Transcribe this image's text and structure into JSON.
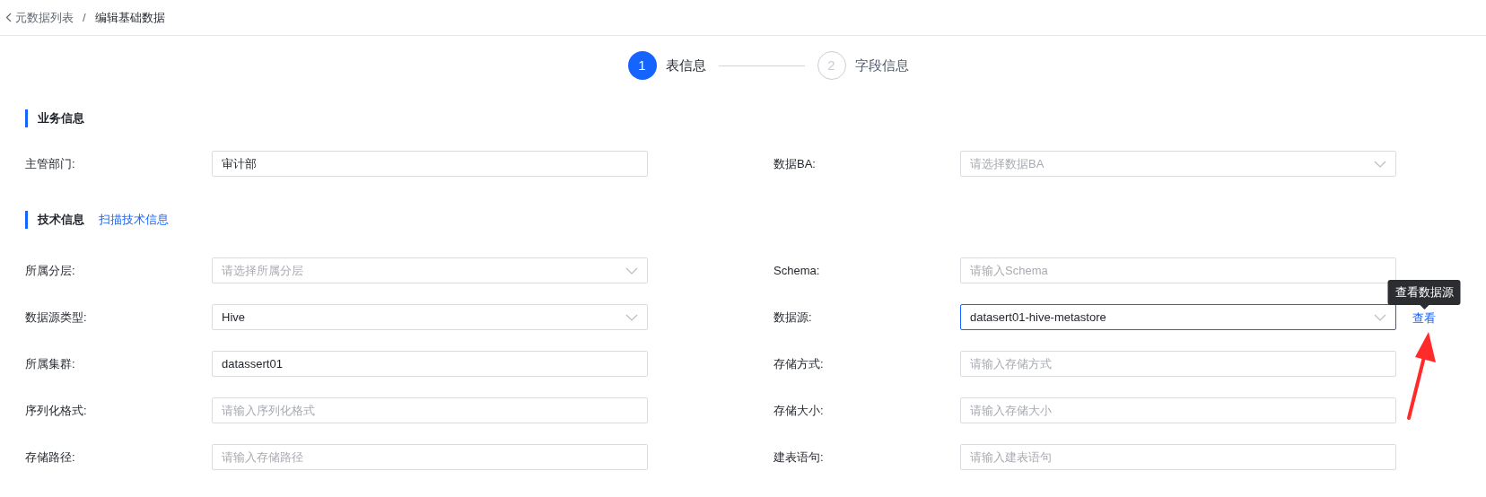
{
  "breadcrumb": {
    "back": "元数据列表",
    "separator": "/",
    "current": "编辑基础数据"
  },
  "steps": [
    {
      "number": "1",
      "label": "表信息",
      "selected": true
    },
    {
      "number": "2",
      "label": "字段信息",
      "selected": false
    }
  ],
  "sections": [
    {
      "title": "业务信息",
      "rows": [
        [
          {
            "label": "主管部门:",
            "kind": "input",
            "value": "审计部",
            "focused": false
          },
          {
            "label": "数据BA:",
            "kind": "select",
            "placeholder": "请选择数据BA",
            "focused": false
          }
        ]
      ]
    },
    {
      "title": "技术信息",
      "link": "扫描技术信息",
      "rows": [
        [
          {
            "label": "所属分层:",
            "kind": "select",
            "placeholder": "请选择所属分层",
            "focused": false
          },
          {
            "label": "Schema:",
            "kind": "input",
            "placeholder": "请输入Schema",
            "focused": false
          }
        ],
        [
          {
            "label": "数据源类型:",
            "kind": "select",
            "value": "Hive",
            "focused": false
          },
          {
            "label": "数据源:",
            "kind": "select",
            "value": "datasert01-hive-metastore",
            "focused": true,
            "action": {
              "label": "查看",
              "tooltip": "查看数据源"
            }
          }
        ],
        [
          {
            "label": "所属集群:",
            "kind": "input",
            "value": "datassert01",
            "focused": false
          },
          {
            "label": "存储方式:",
            "kind": "input",
            "placeholder": "请输入存储方式",
            "focused": false
          }
        ],
        [
          {
            "label": "序列化格式:",
            "kind": "input",
            "placeholder": "请输入序列化格式",
            "focused": false
          },
          {
            "label": "存储大小:",
            "kind": "input",
            "placeholder": "请输入存储大小",
            "focused": false
          }
        ],
        [
          {
            "label": "存储路径:",
            "kind": "input",
            "placeholder": "请输入存储路径",
            "focused": false
          },
          {
            "label": "建表语句:",
            "kind": "input",
            "placeholder": "请输入建表语句",
            "focused": false
          }
        ]
      ]
    }
  ]
}
